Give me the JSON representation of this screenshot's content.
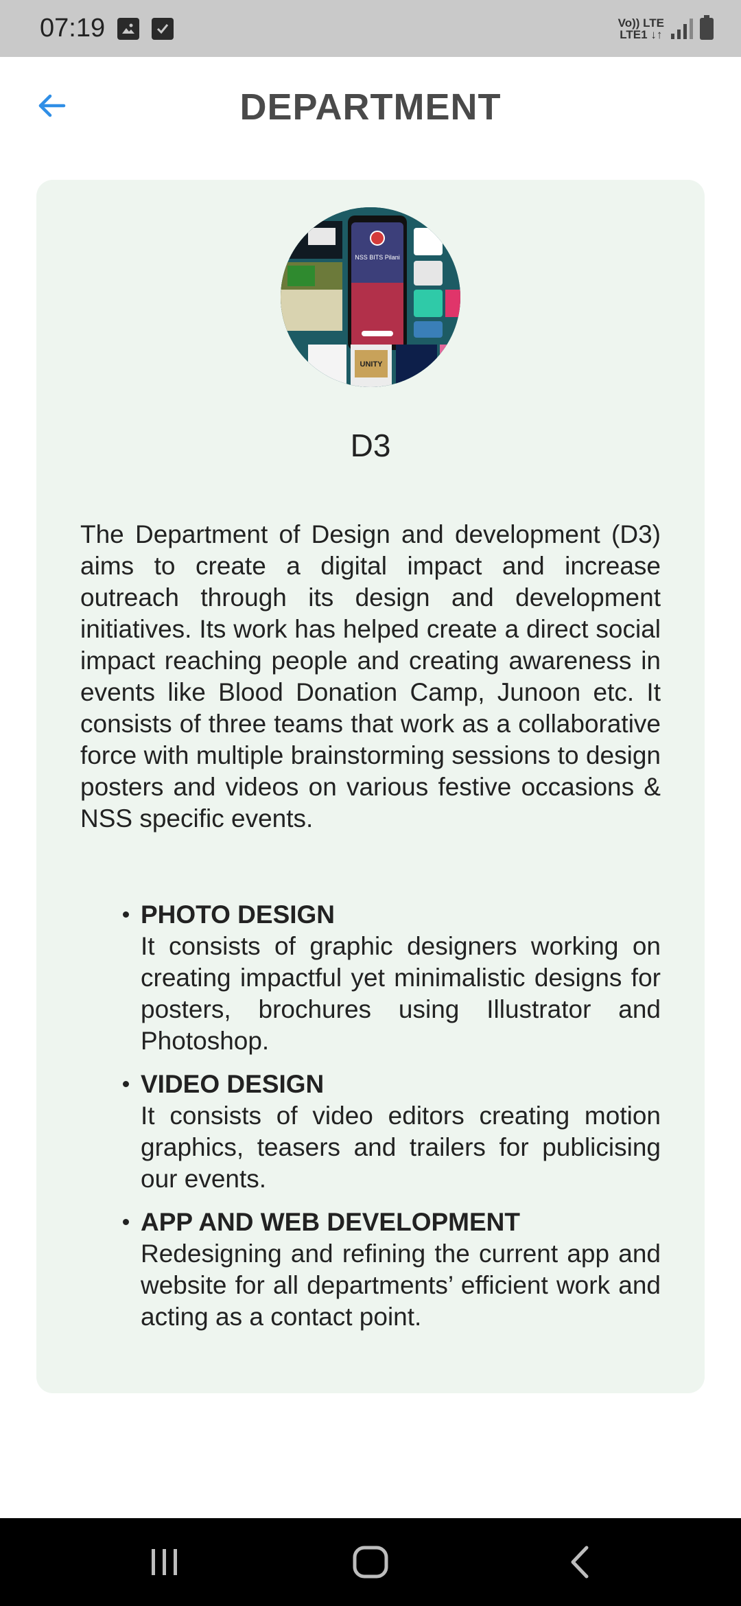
{
  "status_bar": {
    "time": "07:19",
    "lte_top": "Vo)) LTE",
    "lte_bottom": "LTE1 ↓↑"
  },
  "header": {
    "title": "DEPARTMENT",
    "back_icon": "arrow-left-icon",
    "accent_color": "#2f8ee6"
  },
  "department": {
    "name": "D3",
    "description": "The Department of Design and development (D3) aims to create a digital impact and increase outreach through its design and development initiatives. Its work has helped create a direct social impact reaching people and creating awareness in events like Blood Donation Camp, Junoon etc. It consists of three teams that work as a collaborative force with multiple brainstorming sessions to design posters and videos on various festive occasions & NSS specific events.",
    "teams": [
      {
        "title": "PHOTO DESIGN",
        "desc": "It consists of graphic designers working on creating impactful yet minimalistic designs for posters, brochures using Illustrator and Photoshop."
      },
      {
        "title": "VIDEO DESIGN",
        "desc": "It consists of video editors creating motion graphics, teasers and trailers for publicising our events."
      },
      {
        "title": "APP AND WEB DEVELOPMENT",
        "desc": "Redesigning and refining the current app and website for all departments’ efficient work and acting as a contact point."
      }
    ]
  },
  "avatar": {
    "phone_label": "NSS BITS Pilani",
    "poster_label": "UNITY"
  },
  "nav": {
    "recents_icon": "recents-icon",
    "home_icon": "home-icon",
    "back_icon": "back-chevron-icon"
  }
}
